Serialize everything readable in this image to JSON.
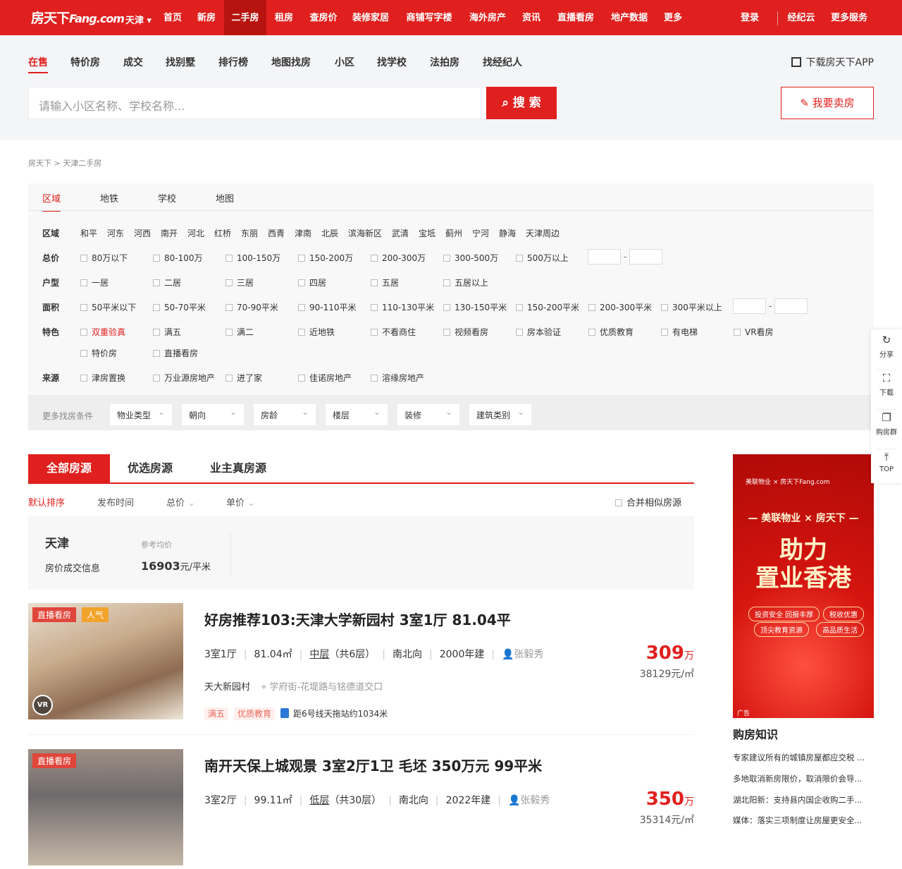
{
  "header": {
    "logo": "房天下",
    "logo_en": "Fang.com",
    "city": "天津",
    "nav": [
      "首页",
      "新房",
      "二手房",
      "租房",
      "查房价",
      "装修家居",
      "商铺写字楼",
      "海外房产",
      "资讯",
      "直播看房",
      "地产数据",
      "更多"
    ],
    "active_nav": "二手房",
    "login": "登录",
    "agent_cloud": "经纪云",
    "more_services": "更多服务"
  },
  "subnav": {
    "tabs": [
      "在售",
      "特价房",
      "成交",
      "找别墅",
      "排行榜",
      "地图找房",
      "小区",
      "找学校",
      "法拍房",
      "找经纪人"
    ],
    "active": "在售",
    "download_app": "下载房天下APP",
    "search_placeholder": "请输入小区名称、学校名称...",
    "search_button": "搜 索",
    "sell_button": "我要卖房"
  },
  "breadcrumb": "房天下 > 天津二手房",
  "filter": {
    "tabs": [
      "区域",
      "地铁",
      "学校",
      "地图"
    ],
    "active_tab": "区域",
    "labels": {
      "district": "区域",
      "price": "总价",
      "layout": "户型",
      "area": "面积",
      "feature": "特色",
      "source": "来源"
    },
    "districts": [
      "和平",
      "河东",
      "河西",
      "南开",
      "河北",
      "红桥",
      "东丽",
      "西青",
      "津南",
      "北辰",
      "滨海新区",
      "武清",
      "宝坻",
      "蓟州",
      "宁河",
      "静海",
      "天津周边"
    ],
    "prices": [
      "80万以下",
      "80-100万",
      "100-150万",
      "150-200万",
      "200-300万",
      "300-500万",
      "500万以上"
    ],
    "layouts": [
      "一居",
      "二居",
      "三居",
      "四居",
      "五居",
      "五居以上"
    ],
    "areas": [
      "50平米以下",
      "50-70平米",
      "70-90平米",
      "90-110平米",
      "110-130平米",
      "130-150平米",
      "150-200平米",
      "200-300平米",
      "300平米以上"
    ],
    "features": [
      "双重验真",
      "满五",
      "满二",
      "近地铁",
      "不看商住",
      "视频看房",
      "房本验证",
      "优质教育",
      "有电梯",
      "VR看房",
      "特价房",
      "直播看房"
    ],
    "sources": [
      "津房置换",
      "万业源房地产",
      "进了家",
      "佳诺房地产",
      "溶缘房地产"
    ],
    "range_dash": "-",
    "more_label": "更多找房条件",
    "more_dropdowns": [
      "物业类型",
      "朝向",
      "房龄",
      "楼层",
      "装修",
      "建筑类别"
    ]
  },
  "list_tabs": [
    "全部房源",
    "优选房源",
    "业主真房源"
  ],
  "active_list_tab": "全部房源",
  "sort": [
    "默认排序",
    "发布时间",
    "总价",
    "单价"
  ],
  "active_sort": "默认排序",
  "merge_label": "合并相似房源",
  "price_info": {
    "city": "天津",
    "link": "房价成交信息",
    "avg_label": "参考均价",
    "avg_value": "16903",
    "avg_unit": "元/平米"
  },
  "listings": [
    {
      "title": "好房推荐103:天津大学新园村 3室1厅 81.04平",
      "badges": [
        "直播看房",
        "人气"
      ],
      "layout": "3室1厅",
      "area": "81.04㎡",
      "floor": "中层",
      "floor_total": "（共6层）",
      "orientation": "南北向",
      "year": "2000年建",
      "agent": "张毅秀",
      "community": "天大新园村",
      "address": "学府街-花堤路与铭德道交口",
      "tags": [
        "满五",
        "优质教育"
      ],
      "subway": "距6号线天拖站约1034米",
      "price": "309",
      "price_unit": "万",
      "unit_price": "38129元/㎡",
      "vr": "VR"
    },
    {
      "title": "南开天保上城观景 3室2厅1卫 毛坯 350万元 99平米",
      "badges": [
        "直播看房"
      ],
      "layout": "3室2厅",
      "area": "99.11㎡",
      "floor": "低层",
      "floor_total": "（共30层）",
      "orientation": "南北向",
      "year": "2022年建",
      "agent": "张毅秀",
      "price": "350",
      "price_unit": "万",
      "unit_price": "35314元/㎡"
    }
  ],
  "ad": {
    "brand": "美联物业 × 房天下Fang.com",
    "line1": "— 美联物业 × 房天下 —",
    "line2a": "助力",
    "line2b": "置业香港",
    "tags": [
      "投资安全 回报丰厚",
      "税收优惠",
      "顶尖教育资源",
      "高品质生活"
    ],
    "label": "广告"
  },
  "knowledge": {
    "title": "购房知识",
    "items": [
      "专家建议所有的城镇房屋都应交税 ...",
      "多地取消新房限价，取消限价会导...",
      "湖北阳新：支持县内国企收购二手...",
      "媒体：落实三项制度让房屋更安全..."
    ]
  },
  "float_bar": [
    "分享",
    "下载",
    "购房群",
    "TOP"
  ],
  "colors": {
    "brand_red": "#e0201e"
  }
}
